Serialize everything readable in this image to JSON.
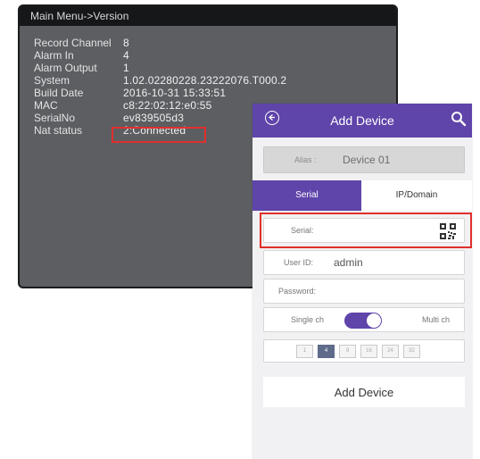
{
  "dvr": {
    "title": "Main Menu->Version",
    "rows": [
      {
        "label": "Record Channel",
        "value": "8"
      },
      {
        "label": "Alarm In",
        "value": "4"
      },
      {
        "label": "Alarm Output",
        "value": "1"
      },
      {
        "label": "System",
        "value": "1.02.02280228.23222076.T000.2"
      },
      {
        "label": "Build Date",
        "value": "2016-10-31 15:33:51"
      },
      {
        "label": "MAC",
        "value": "c8:22:02:12:e0:55"
      },
      {
        "label": "SerialNo",
        "value": "ev839505d3"
      },
      {
        "label": "Nat status",
        "value": "2:Connected"
      }
    ]
  },
  "app": {
    "title": "Add Device",
    "alias": {
      "label": "Alias :",
      "value": "Device 01"
    },
    "tabs": {
      "serial": "Serial",
      "ip": "IP/Domain"
    },
    "serial": {
      "label": "Serial:"
    },
    "user": {
      "label": "User ID:",
      "value": "admin"
    },
    "password": {
      "label": "Password:"
    },
    "toggle": {
      "left": "Single ch",
      "right": "Multi ch"
    },
    "channels": [
      "1",
      "4",
      "9",
      "16",
      "24",
      "32"
    ],
    "add_button": "Add Device"
  },
  "colors": {
    "accent": "#5f44aa",
    "highlight": "#e0302c"
  }
}
